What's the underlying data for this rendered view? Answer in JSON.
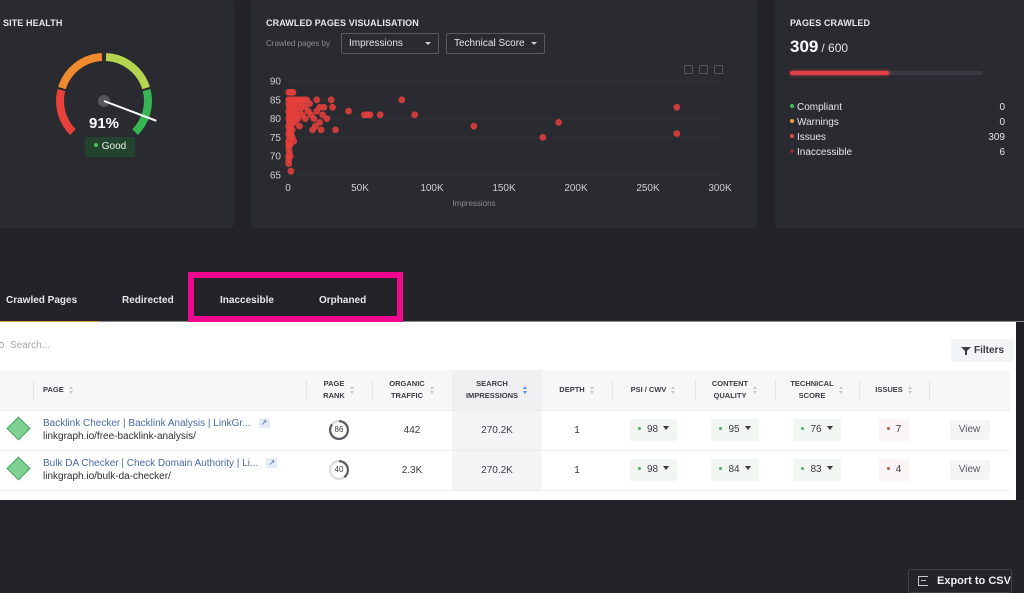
{
  "site_health": {
    "title": "SITE HEALTH",
    "percent": 91,
    "percent_label": "91%",
    "status": "Good",
    "colors": {
      "red": "#e8413c",
      "orange": "#f08a2e",
      "lime": "#b5d44f",
      "green": "#35b652"
    }
  },
  "visualisation": {
    "title": "CRAWLED PAGES VISUALISATION",
    "by_label": "Crawled pages by",
    "x_select": "Impressions",
    "y_select": "Technical Score",
    "toolbar_icons": [
      "zoom-select-icon",
      "zoom-reset-icon",
      "download-icon"
    ]
  },
  "chart_data": {
    "type": "scatter",
    "title": "",
    "xlabel": "Impressions",
    "ylabel": "",
    "xlim": [
      0,
      300000
    ],
    "ylim": [
      65,
      90
    ],
    "x_ticks": [
      "0",
      "50K",
      "100K",
      "150K",
      "200K",
      "250K",
      "300K"
    ],
    "y_ticks": [
      "90",
      "85",
      "80",
      "75",
      "70",
      "65"
    ],
    "grid": true,
    "marker_color": "#e8403c",
    "points": [
      [
        500,
        87
      ],
      [
        2000,
        87
      ],
      [
        3500,
        87
      ],
      [
        500,
        85
      ],
      [
        1500,
        85
      ],
      [
        3000,
        85
      ],
      [
        5000,
        85
      ],
      [
        7000,
        85
      ],
      [
        9000,
        85
      ],
      [
        11000,
        85
      ],
      [
        13000,
        85
      ],
      [
        20000,
        85
      ],
      [
        30000,
        85
      ],
      [
        79000,
        85
      ],
      [
        500,
        84
      ],
      [
        2000,
        84
      ],
      [
        4000,
        84
      ],
      [
        7000,
        84
      ],
      [
        10000,
        84
      ],
      [
        15000,
        84
      ],
      [
        1000,
        83
      ],
      [
        3000,
        83
      ],
      [
        6000,
        83
      ],
      [
        9000,
        83
      ],
      [
        12000,
        83
      ],
      [
        22000,
        83
      ],
      [
        25000,
        83
      ],
      [
        31000,
        83
      ],
      [
        270000,
        83
      ],
      [
        500,
        82
      ],
      [
        2500,
        82
      ],
      [
        5000,
        82
      ],
      [
        8000,
        82
      ],
      [
        14000,
        82
      ],
      [
        20000,
        82
      ],
      [
        42000,
        82
      ],
      [
        1000,
        81
      ],
      [
        3000,
        81
      ],
      [
        6000,
        81
      ],
      [
        10000,
        81
      ],
      [
        16000,
        81
      ],
      [
        24000,
        81
      ],
      [
        53000,
        81
      ],
      [
        55000,
        81
      ],
      [
        57000,
        81
      ],
      [
        64000,
        81
      ],
      [
        88000,
        81
      ],
      [
        500,
        80
      ],
      [
        2000,
        80
      ],
      [
        4000,
        80
      ],
      [
        7000,
        80
      ],
      [
        12000,
        80
      ],
      [
        18000,
        80
      ],
      [
        27000,
        80
      ],
      [
        1000,
        79
      ],
      [
        3000,
        79
      ],
      [
        5000,
        79
      ],
      [
        22000,
        79
      ],
      [
        188000,
        79
      ],
      [
        500,
        78
      ],
      [
        2000,
        78
      ],
      [
        8000,
        78
      ],
      [
        19000,
        78
      ],
      [
        129000,
        78
      ],
      [
        1000,
        77
      ],
      [
        3000,
        77
      ],
      [
        17000,
        77
      ],
      [
        23000,
        77
      ],
      [
        33000,
        77
      ],
      [
        500,
        76
      ],
      [
        2000,
        76
      ],
      [
        270000,
        76
      ],
      [
        1000,
        75
      ],
      [
        3000,
        75
      ],
      [
        177000,
        75
      ],
      [
        500,
        74
      ],
      [
        4000,
        74
      ],
      [
        500,
        73
      ],
      [
        1500,
        73
      ],
      [
        500,
        72
      ],
      [
        1000,
        71
      ],
      [
        500,
        70
      ],
      [
        1500,
        70
      ],
      [
        500,
        69
      ],
      [
        500,
        68
      ],
      [
        2000,
        66
      ]
    ]
  },
  "pages_crawled": {
    "title": "PAGES CRAWLED",
    "crawled": "309",
    "total": "/ 600",
    "progress_fraction": 0.515,
    "legend": [
      {
        "label": "Compliant",
        "value": "0",
        "color": "#3fbf5c"
      },
      {
        "label": "Warnings",
        "value": "0",
        "color": "#e8a23c"
      },
      {
        "label": "Issues",
        "value": "309",
        "color": "#e0484c"
      },
      {
        "label": "Inaccessible",
        "value": "6",
        "color": "#8a2a34"
      }
    ]
  },
  "tabs": [
    {
      "label": "Crawled Pages",
      "active": true
    },
    {
      "label": "Redirected",
      "active": false
    },
    {
      "label": "Inaccesible",
      "active": false
    },
    {
      "label": "Orphaned",
      "active": false
    }
  ],
  "export_label": "Export to CSV",
  "search_placeholder": "Search...",
  "filters_label": "Filters",
  "table": {
    "columns": [
      {
        "l1": "",
        "l2": ""
      },
      {
        "l1": "PAGE",
        "l2": ""
      },
      {
        "l1": "PAGE",
        "l2": "RANK"
      },
      {
        "l1": "ORGANIC",
        "l2": "TRAFFIC"
      },
      {
        "l1": "SEARCH",
        "l2": "IMPRESSIONS"
      },
      {
        "l1": "DEPTH",
        "l2": ""
      },
      {
        "l1": "PSI / CWV",
        "l2": ""
      },
      {
        "l1": "CONTENT",
        "l2": "QUALITY"
      },
      {
        "l1": "TECHNICAL",
        "l2": "SCORE"
      },
      {
        "l1": "ISSUES",
        "l2": ""
      },
      {
        "l1": "",
        "l2": ""
      }
    ],
    "rows": [
      {
        "title": "Backlink Checker | Backlink Analysis | LinkGr...",
        "url": "linkgraph.io/free-backlink-analysis/",
        "page_rank": "86",
        "organic_traffic": "442",
        "search_impressions": "270.2K",
        "depth": "1",
        "psi_cwv": "98",
        "content_quality": "95",
        "technical_score": "76",
        "issues": "7",
        "action": "View"
      },
      {
        "title": "Bulk DA Checker | Check Domain Authority | Li...",
        "url": "linkgraph.io/bulk-da-checker/",
        "page_rank": "40",
        "organic_traffic": "2.3K",
        "search_impressions": "270.2K",
        "depth": "1",
        "psi_cwv": "98",
        "content_quality": "84",
        "technical_score": "83",
        "issues": "4",
        "action": "View"
      }
    ]
  }
}
